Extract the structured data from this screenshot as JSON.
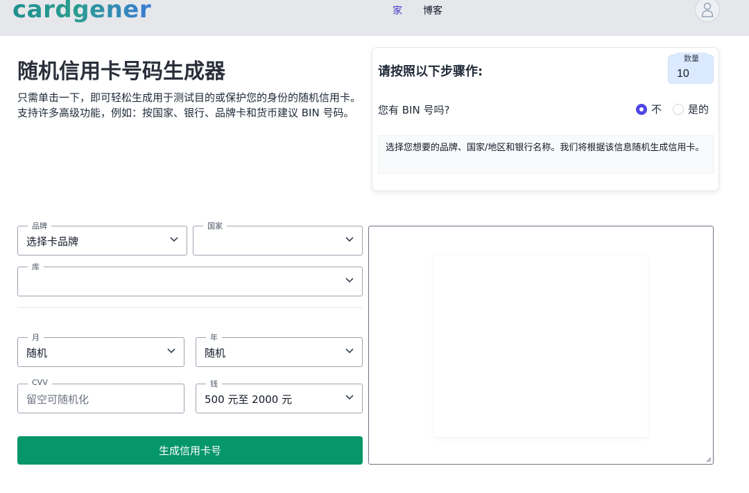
{
  "header": {
    "logo": "cardgener",
    "nav": [
      {
        "label": "家"
      },
      {
        "label": "博客"
      }
    ]
  },
  "hero": {
    "title": "随机信用卡号码生成器",
    "description": "只需单击一下，即可轻松生成用于测试目的或保护您的身份的随机信用卡。支持许多高级功能，例如：按国家、银行、品牌卡和货币建议 BIN 号码。"
  },
  "steps": {
    "title": "请按照以下步骤作:",
    "quantity_label": "数量",
    "quantity_value": "10",
    "bin_question": "您有 BIN 号吗?",
    "radio_no": "不",
    "radio_yes": "是的",
    "hint": "选择您想要的品牌、国家/地区和银行名称。我们将根据该信息随机生成信用卡。"
  },
  "form": {
    "brand": {
      "label": "品牌",
      "value": "选择卡品牌"
    },
    "country": {
      "label": "国家",
      "value": ""
    },
    "bank": {
      "label": "库",
      "value": ""
    },
    "month": {
      "label": "月",
      "value": "随机"
    },
    "year": {
      "label": "年",
      "value": "随机"
    },
    "cvv": {
      "label": "CVV",
      "placeholder": "留空可随机化"
    },
    "money": {
      "label": "钱",
      "value": "500 元至 2000 元"
    },
    "generate_button": "生成信用卡号"
  },
  "icons": {
    "avatar": "user-icon",
    "chevron": "chevron-down-icon",
    "resize": "resize-handle-icon"
  },
  "colors": {
    "accent": "#4f46e5",
    "button": "#059669",
    "quantity_bg": "#dbeafe"
  }
}
